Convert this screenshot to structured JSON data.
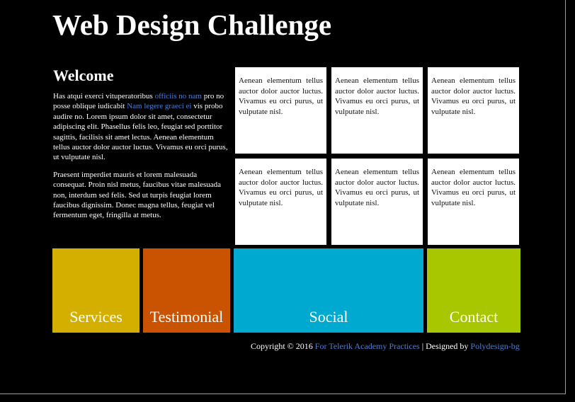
{
  "header": {
    "title": "Web Design Challenge"
  },
  "welcome": {
    "heading": "Welcome",
    "p1_intro": "Has atqui exerci vituperatoribus ",
    "p1_link1": "officiis no nam",
    "p1_mid": " pro no posse oblique iudicabit ",
    "p1_link2": "Nam legere graeci ei",
    "p1_rest": " vis probo audire no. Lorem ipsum dolor sit amet, consectetur adipiscing elit. Phasellus felis leo, feugiat sed porttitor sagittis, facilisis sit amet lectus. Aenean elementum tellus auctor dolor auctor luctus. Vivamus eu orci purus, ut vulputate nisl.",
    "p2": "Praesent imperdiet mauris et lorem malesuada consequat. Proin nisl metus, faucibus vitae malesuada non, interdum sed felis. Sed ut turpis feugiat lorem faucibus dignissim. Donec magna tellus, feugiat vel fermentum eget, fringilla at metus."
  },
  "cards": [
    "Aenean elementum tellus auctor dolor auctor luctus. Vivamus eu orci purus, ut vulputate nisl.",
    "Aenean elementum tellus auctor dolor auctor luctus. Vivamus eu orci purus, ut vulputate nisl.",
    "Aenean elementum tellus auctor dolor auctor luctus. Vivamus eu orci purus, ut vulputate nisl.",
    "Aenean elementum tellus auctor dolor auctor luctus. Vivamus eu orci purus, ut vulputate nisl.",
    "Aenean elementum tellus auctor dolor auctor luctus. Vivamus eu orci purus, ut vulputate nisl.",
    "Aenean elementum tellus auctor dolor auctor luctus. Vivamus eu orci purus, ut vulputate nisl."
  ],
  "tiles": {
    "services": {
      "label": "Services",
      "color": "#d4af00"
    },
    "testimonial": {
      "label": "Testimonial",
      "color": "#c95300"
    },
    "social": {
      "label": "Social",
      "color": "#00a9cf"
    },
    "contact": {
      "label": "Contact",
      "color": "#a9c700"
    }
  },
  "footer": {
    "copyright": "Copyright © 2016 ",
    "link1": "For Telerik Academy Practices",
    "designed": " | Designed by ",
    "link2": "Polydesign-bg"
  },
  "colors": {
    "background": "#000000",
    "link": "#4a7fd6"
  }
}
